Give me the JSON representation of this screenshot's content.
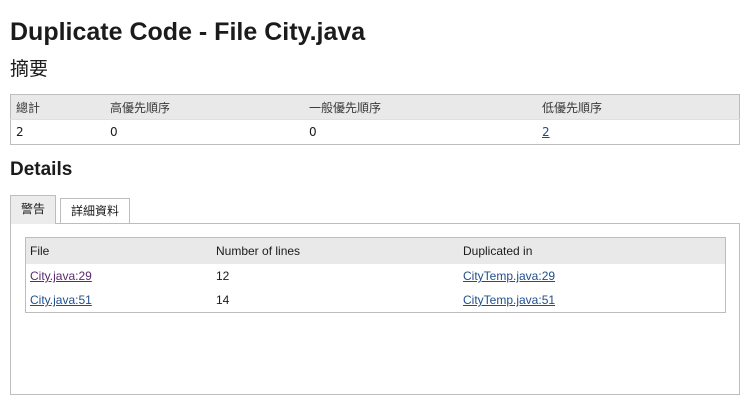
{
  "page": {
    "title": "Duplicate Code - File City.java"
  },
  "summary": {
    "heading": "摘要",
    "headers": [
      "總計",
      "高優先順序",
      "一般優先順序",
      "低優先順序"
    ],
    "values": [
      "2",
      "0",
      "0",
      "2"
    ]
  },
  "details": {
    "heading": "Details",
    "tabs": [
      {
        "label": "警告",
        "active": true
      },
      {
        "label": "詳細資料",
        "active": false
      }
    ],
    "table": {
      "headers": [
        "File",
        "Number of lines",
        "Duplicated in"
      ],
      "rows": [
        {
          "file": "City.java:29",
          "lines": "12",
          "duplicated_in": "CityTemp.java:29"
        },
        {
          "file": "City.java:51",
          "lines": "14",
          "duplicated_in": "CityTemp.java:51"
        }
      ]
    }
  },
  "colors": {
    "link": "#1f4e8c",
    "visited_link": "#5a2a6e",
    "header_bg": "#e9e9e9",
    "border": "#bdbdbd"
  }
}
